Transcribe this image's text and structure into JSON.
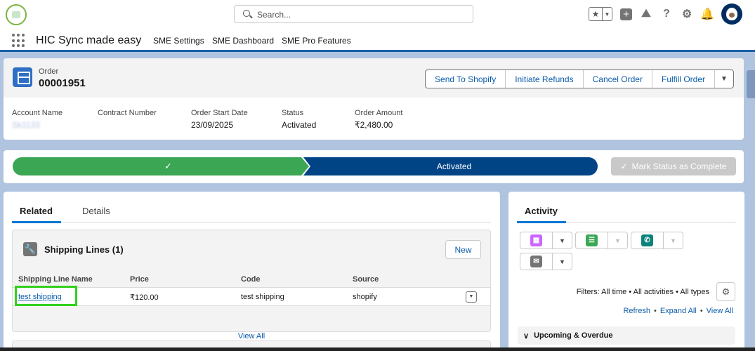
{
  "header": {
    "search_placeholder": "Search...",
    "icons": [
      "favorites-star-icon",
      "add-icon",
      "trailhead-icon",
      "help-icon",
      "setup-gear-icon",
      "notifications-bell-icon",
      "user-avatar"
    ]
  },
  "app_nav": {
    "app_name": "HIC Sync made easy",
    "tabs": [
      "SME Settings",
      "SME Dashboard",
      "SME Pro Features"
    ]
  },
  "record": {
    "object_label": "Order",
    "title": "00001951",
    "actions": [
      "Send To Shopify",
      "Initiate Refunds",
      "Cancel Order",
      "Fulfill Order"
    ],
    "fields": [
      {
        "label": "Account Name",
        "value": "Sk1133"
      },
      {
        "label": "Contract Number",
        "value": ""
      },
      {
        "label": "Order Start Date",
        "value": "23/09/2025"
      },
      {
        "label": "Status",
        "value": "Activated"
      },
      {
        "label": "Order Amount",
        "value": "₹2,480.00"
      }
    ]
  },
  "path": {
    "completed_symbol": "✓",
    "active_stage": "Activated",
    "mark_button": "Mark Status as Complete"
  },
  "related": {
    "tabs": [
      "Related",
      "Details"
    ],
    "card_title": "Shipping Lines (1)",
    "new_button": "New",
    "columns": [
      "Shipping Line Name",
      "Price",
      "Code",
      "Source"
    ],
    "rows": [
      [
        "test shipping",
        "₹120.00",
        "test shipping",
        "shopify"
      ]
    ],
    "view_all": "View All"
  },
  "activity": {
    "tab": "Activity",
    "filters": "Filters: All time • All activities • All types",
    "links": [
      "Refresh",
      "Expand All",
      "View All"
    ],
    "upcoming": "Upcoming & Overdue",
    "colors": {
      "event": "#cb65ff",
      "task": "#3ba755",
      "call": "#0b827c",
      "email": "#747474"
    }
  },
  "colors": {
    "brand_blue": "#0176d3",
    "path_complete": "#3ba755",
    "path_active": "#014486",
    "highlight": "#33d01d"
  }
}
